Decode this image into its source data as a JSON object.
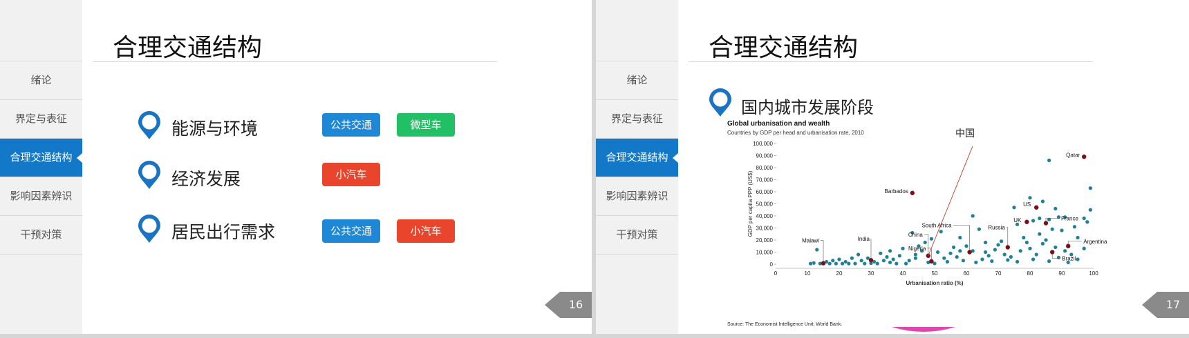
{
  "slides": [
    {
      "title": "合理交通结构",
      "nav": [
        "绪论",
        "界定与表征",
        "合理交通结构",
        "影响因素辨识",
        "干预对策"
      ],
      "active_index": 2,
      "rows": [
        {
          "label": "能源与环境",
          "tags": [
            {
              "text": "公共交通",
              "color": "blue"
            },
            {
              "text": "微型车",
              "color": "green"
            }
          ]
        },
        {
          "label": "经济发展",
          "tags": [
            {
              "text": "小汽车",
              "color": "red"
            }
          ]
        },
        {
          "label": "居民出行需求",
          "tags": [
            {
              "text": "公共交通",
              "color": "blue"
            },
            {
              "text": "小汽车",
              "color": "red"
            }
          ]
        }
      ],
      "page": "16"
    },
    {
      "title": "合理交通结构",
      "nav": [
        "绪论",
        "界定与表征",
        "合理交通结构",
        "影响因素辨识",
        "干预对策"
      ],
      "active_index": 2,
      "subhead": "国内城市发展阶段",
      "page": "17"
    }
  ],
  "colors": {
    "accent": "#1478c8",
    "tag_blue": "#1e88d6",
    "tag_green": "#21c064",
    "tag_red": "#e8452c",
    "point": "#1f7f95",
    "highlight": "#7a0f1a"
  },
  "chart_data": {
    "type": "scatter",
    "title": "Global urbanisation and wealth",
    "subtitle": "Countries by GDP per head and urbanisation rate, 2010",
    "xlabel": "Urbanisation ratio (%)",
    "ylabel": "GDP per capita PPP (US$)",
    "source": "Source: The Economist Intelligence Unit; World Bank.",
    "annotation": "中国",
    "xlim": [
      0,
      100
    ],
    "ylim": [
      0,
      100000
    ],
    "xticks": [
      "0",
      "10",
      "20",
      "30",
      "40",
      "50",
      "60",
      "70",
      "80",
      "90",
      "100"
    ],
    "yticks": [
      "0",
      "10,000",
      "20,000",
      "30,000",
      "40,000",
      "50,000",
      "60,000",
      "70,000",
      "80,000",
      "90,000",
      "100,000"
    ],
    "highlighted": [
      {
        "name": "Qatar",
        "x": 97,
        "y": 89000
      },
      {
        "name": "Barbados",
        "x": 43,
        "y": 59000
      },
      {
        "name": "US",
        "x": 82,
        "y": 47000
      },
      {
        "name": "France",
        "x": 85,
        "y": 34000
      },
      {
        "name": "UK",
        "x": 79,
        "y": 35000
      },
      {
        "name": "South Africa",
        "x": 61,
        "y": 10000
      },
      {
        "name": "Russia",
        "x": 73,
        "y": 14000
      },
      {
        "name": "China",
        "x": 48,
        "y": 7000
      },
      {
        "name": "Nigeria",
        "x": 49,
        "y": 2400
      },
      {
        "name": "India",
        "x": 30,
        "y": 3300
      },
      {
        "name": "Malawi",
        "x": 15,
        "y": 800
      },
      {
        "name": "Argentina",
        "x": 92,
        "y": 15000
      },
      {
        "name": "Brazil",
        "x": 87,
        "y": 10000
      }
    ],
    "points": [
      [
        86,
        86000
      ],
      [
        99,
        63000
      ],
      [
        99,
        45000
      ],
      [
        97,
        38000
      ],
      [
        98,
        35000
      ],
      [
        91,
        39000
      ],
      [
        89,
        39000
      ],
      [
        86,
        37000
      ],
      [
        84,
        52000
      ],
      [
        80,
        55000
      ],
      [
        88,
        46000
      ],
      [
        75,
        47000
      ],
      [
        62,
        40000
      ],
      [
        83,
        38000
      ],
      [
        81,
        36000
      ],
      [
        76,
        33000
      ],
      [
        94,
        31000
      ],
      [
        87,
        29000
      ],
      [
        90,
        28000
      ],
      [
        83,
        25000
      ],
      [
        95,
        22000
      ],
      [
        78,
        22000
      ],
      [
        85,
        20000
      ],
      [
        71,
        19000
      ],
      [
        64,
        29000
      ],
      [
        66,
        18000
      ],
      [
        58,
        22000
      ],
      [
        52,
        27000
      ],
      [
        49,
        21000
      ],
      [
        47,
        18000
      ],
      [
        43,
        26000
      ],
      [
        45,
        15000
      ],
      [
        40,
        13000
      ],
      [
        36,
        11000
      ],
      [
        33,
        9000
      ],
      [
        26,
        8000
      ],
      [
        29,
        5000
      ],
      [
        31,
        2000
      ],
      [
        20,
        4000
      ],
      [
        18,
        3000
      ],
      [
        12,
        1000
      ],
      [
        13,
        12000
      ],
      [
        22,
        2000
      ],
      [
        24,
        5000
      ],
      [
        35,
        6000
      ],
      [
        37,
        4000
      ],
      [
        42,
        3000
      ],
      [
        44,
        8000
      ],
      [
        53,
        5000
      ],
      [
        55,
        9000
      ],
      [
        57,
        6000
      ],
      [
        60,
        15000
      ],
      [
        62,
        11000
      ],
      [
        65,
        4000
      ],
      [
        67,
        7000
      ],
      [
        69,
        12000
      ],
      [
        70,
        16000
      ],
      [
        72,
        8000
      ],
      [
        74,
        6000
      ],
      [
        77,
        11000
      ],
      [
        79,
        18000
      ],
      [
        80,
        13000
      ],
      [
        82,
        8000
      ],
      [
        84,
        17000
      ],
      [
        88,
        14000
      ],
      [
        91,
        11000
      ],
      [
        93,
        8000
      ],
      [
        95,
        4000
      ],
      [
        97,
        13000
      ],
      [
        56,
        14000
      ],
      [
        51,
        10000
      ],
      [
        46,
        11000
      ],
      [
        39,
        7000
      ],
      [
        34,
        3000
      ],
      [
        27,
        3000
      ],
      [
        16,
        2000
      ],
      [
        11,
        500
      ],
      [
        14,
        500
      ],
      [
        17,
        500
      ],
      [
        19,
        500
      ],
      [
        21,
        500
      ],
      [
        23,
        500
      ],
      [
        25,
        500
      ],
      [
        28,
        500
      ],
      [
        32,
        500
      ],
      [
        38,
        500
      ],
      [
        41,
        500
      ],
      [
        48,
        1500
      ],
      [
        50,
        600
      ],
      [
        54,
        2000
      ],
      [
        59,
        3000
      ],
      [
        63,
        1500
      ],
      [
        68,
        2500
      ],
      [
        73,
        3500
      ],
      [
        76,
        2000
      ],
      [
        81,
        4000
      ],
      [
        86,
        2500
      ],
      [
        89,
        5500
      ],
      [
        92,
        1500
      ],
      [
        66,
        10000
      ],
      [
        58,
        11000
      ],
      [
        44,
        5000
      ],
      [
        36,
        1500
      ],
      [
        30,
        800
      ]
    ]
  }
}
